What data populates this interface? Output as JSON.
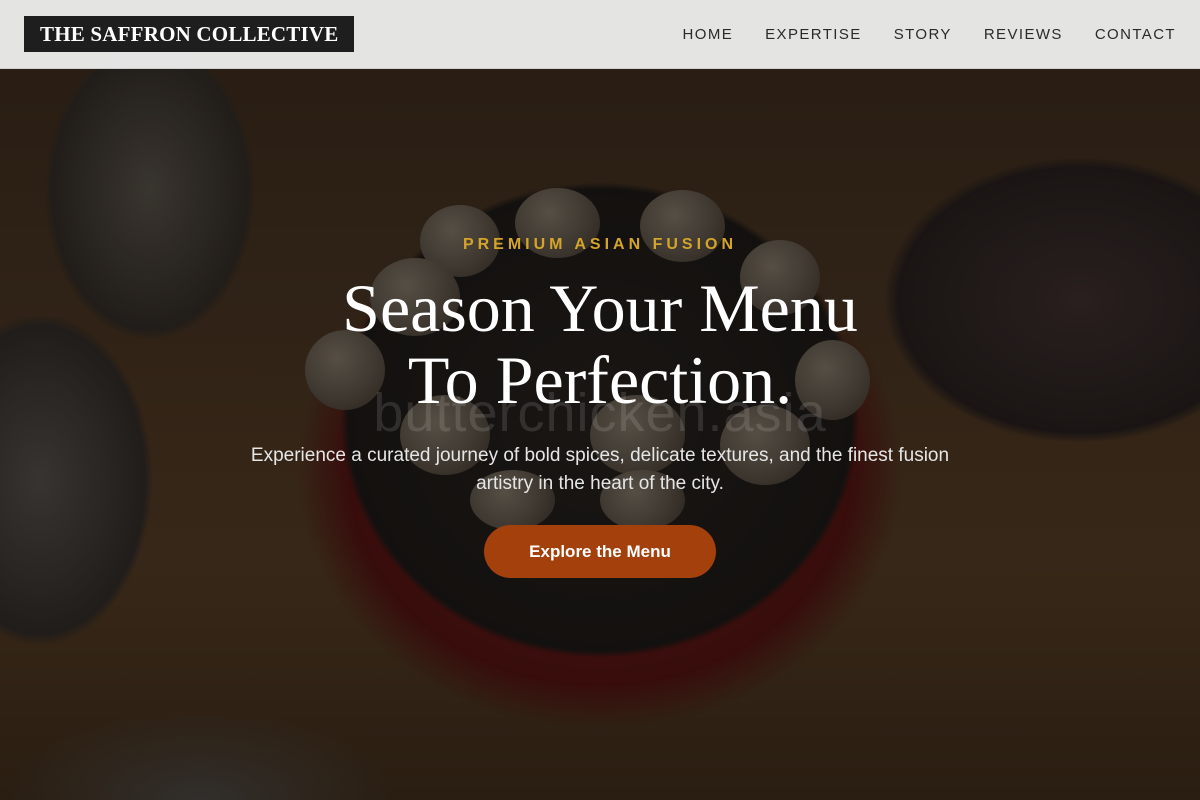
{
  "header": {
    "brand": "THE SAFFRON COLLECTIVE",
    "nav": [
      {
        "label": "HOME"
      },
      {
        "label": "EXPERTISE"
      },
      {
        "label": "STORY"
      },
      {
        "label": "REVIEWS"
      },
      {
        "label": "CONTACT"
      }
    ]
  },
  "hero": {
    "eyebrow": "PREMIUM ASIAN FUSION",
    "headline_line1": "Season Your Menu",
    "headline_line2": "To Perfection.",
    "subtext": "Experience a curated journey of bold spices, delicate textures, and the finest fusion artistry in the heart of the city.",
    "cta_label": "Explore the Menu",
    "watermark": "butterchicken.asia"
  },
  "colors": {
    "accent_gold": "#d4a52a",
    "cta_orange": "#a4400c",
    "header_bg": "#ececec",
    "brand_bg": "#1e1e1e"
  }
}
